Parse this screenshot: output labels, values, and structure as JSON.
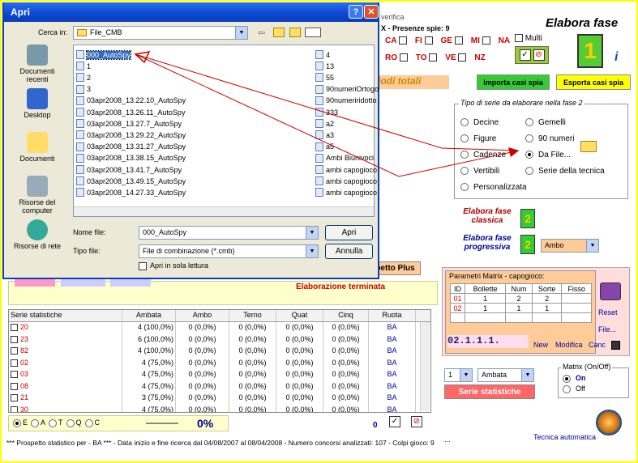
{
  "dialog": {
    "title": "Apri",
    "look_in_label": "Cerca in:",
    "look_in_value": "File_CMB",
    "places": [
      "Documenti recenti",
      "Desktop",
      "Documenti",
      "Risorse del computer",
      "Risorse di rete"
    ],
    "files_left": [
      "000_AutoSpy",
      "1",
      "2",
      "3",
      "03apr2008_13.22.10_AutoSpy",
      "03apr2008_13.26.11_AutoSpy",
      "03apr2008_13.27.7_AutoSpy",
      "03apr2008_13.29.22_AutoSpy",
      "03apr2008_13.31.27_AutoSpy",
      "03apr2008_13.38.15_AutoSpy",
      "03apr2008_13.41.7_AutoSpy",
      "03apr2008_13.49.15_AutoSpy",
      "03apr2008_14.27.33_AutoSpy"
    ],
    "files_right": [
      "4",
      "13",
      "55",
      "90numeriOrtogo",
      "90numeriridotto",
      "333",
      "a2",
      "a3",
      "a5",
      "Ambi Biunivoci",
      "ambi capogioco",
      "ambi capogioco",
      "ambi capogioco"
    ],
    "filename_label": "Nome file:",
    "filename_value": "000_AutoSpy",
    "filetype_label": "Tipo file:",
    "filetype_value": "File di combinazione (*.cmb)",
    "readonly_label": "Apri in sola lettura",
    "open_button": "Apri",
    "cancel_button": "Annulla"
  },
  "top": {
    "verifica": "verifica",
    "presenze": "X - Presenze spie: 9",
    "wheels_row1": [
      "CA",
      "FI",
      "GE",
      "MI",
      "NA"
    ],
    "wheels_row2": [
      "RO",
      "TO",
      "VE",
      "NZ"
    ],
    "multi": "Multi",
    "elabora_fase": "Elabora fase",
    "big_number": "1",
    "periodi": "iodi totali",
    "importa": "Importa casi spia",
    "esporta": "Esporta casi spia"
  },
  "series_type": {
    "legend": "Tipo di serie da elaborare nella fase 2",
    "options_left": [
      "Decine",
      "Figure",
      "Cadenze",
      "Vertibili",
      "Personalizzata"
    ],
    "options_right": [
      "Gemelli",
      "90 numeri",
      "Da File...",
      "Serie della tecnica"
    ],
    "selected": "Da File..."
  },
  "elabora": {
    "classica": "Elabora fase classica",
    "progressiva": "Elabora fase progressiva",
    "num": "2",
    "combo": "Ambo"
  },
  "middle": {
    "prospetto_btn": "petto Plus",
    "status": "Elaborazione terminata"
  },
  "params": {
    "legend": "Parametri Matrix - capogioco:",
    "headers": [
      "ID",
      "Bollette",
      "Num",
      "Sorte",
      "Fisso"
    ],
    "rows": [
      [
        "01",
        "1",
        "2",
        "2",
        ""
      ],
      [
        "02",
        "1",
        "1",
        "1",
        ""
      ]
    ],
    "code": "02.1.1.1.",
    "reset": "Reset",
    "file": "File...",
    "new": "New",
    "modifica": "Modifica",
    "canc": "Canc"
  },
  "stats": {
    "headers": [
      "Serie statistiche",
      "Ambata",
      "Ambo",
      "Terno",
      "Quat",
      "Cinq",
      "Ruota"
    ],
    "rows": [
      [
        "20",
        "4 (100,0%)",
        "0 (0,0%)",
        "0 (0,0%)",
        "0 (0,0%)",
        "0 (0,0%)",
        "BA"
      ],
      [
        "23",
        "6 (100,0%)",
        "0 (0,0%)",
        "0 (0,0%)",
        "0 (0,0%)",
        "0 (0,0%)",
        "BA"
      ],
      [
        "82",
        "4 (100,0%)",
        "0 (0,0%)",
        "0 (0,0%)",
        "0 (0,0%)",
        "0 (0,0%)",
        "BA"
      ],
      [
        "02",
        "4 (75,0%)",
        "0 (0,0%)",
        "0 (0,0%)",
        "0 (0,0%)",
        "0 (0,0%)",
        "BA"
      ],
      [
        "03",
        "4 (75,0%)",
        "0 (0,0%)",
        "0 (0,0%)",
        "0 (0,0%)",
        "0 (0,0%)",
        "BA"
      ],
      [
        "08",
        "4 (75,0%)",
        "0 (0,0%)",
        "0 (0,0%)",
        "0 (0,0%)",
        "0 (0,0%)",
        "BA"
      ],
      [
        "21",
        "3 (75,0%)",
        "0 (0,0%)",
        "0 (0,0%)",
        "0 (0,0%)",
        "0 (0,0%)",
        "BA"
      ],
      [
        "30",
        "4 (75,0%)",
        "0 (0,0%)",
        "0 (0,0%)",
        "0 (0,0%)",
        "0 (0,0%)",
        "BA"
      ]
    ]
  },
  "bottom": {
    "radios": [
      "E",
      "A",
      "T",
      "Q",
      "C"
    ],
    "percent": "0%",
    "zero": "0",
    "status_line": "*** Prospetto statistico per  - BA ***  - Data inizio e fine ricerca dal 04/08/2007 al 08/04/2008 - Numero concorsi analizzati: 107 - Colpi gioco: 9",
    "num_combo": "1",
    "ambata_combo": "Ambata",
    "serie_btn": "Serie statistiche",
    "matrix_legend": "Matrix (On/Off)",
    "on": "On",
    "off": "Off",
    "tecnica": "Tecnica automatica",
    "dots": "..."
  }
}
